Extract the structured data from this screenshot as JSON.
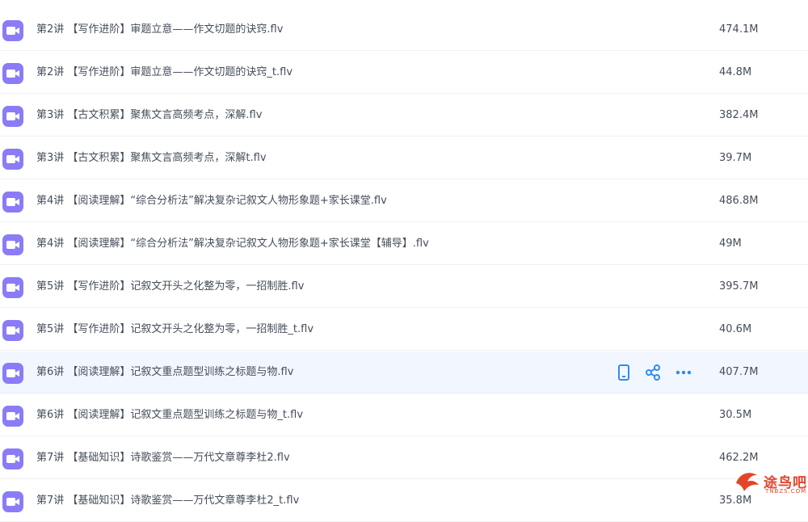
{
  "files": [
    {
      "name": "第2讲 【写作进阶】审题立意——作文切题的诀窍.flv",
      "size": "474.1M"
    },
    {
      "name": "第2讲 【写作进阶】审题立意——作文切题的诀窍_t.flv",
      "size": "44.8M"
    },
    {
      "name": "第3讲 【古文积累】聚焦文言高频考点，深解.flv",
      "size": "382.4M"
    },
    {
      "name": "第3讲 【古文积累】聚焦文言高频考点，深解t.flv",
      "size": "39.7M"
    },
    {
      "name": "第4讲 【阅读理解】“综合分析法”解决复杂记叙文人物形象题+家长课堂.flv",
      "size": "486.8M"
    },
    {
      "name": "第4讲 【阅读理解】“综合分析法”解决复杂记叙文人物形象题+家长课堂【辅导】.flv",
      "size": "49M"
    },
    {
      "name": "第5讲 【写作进阶】记叙文开头之化整为零，一招制胜.flv",
      "size": "395.7M"
    },
    {
      "name": "第5讲 【写作进阶】记叙文开头之化整为零，一招制胜_t.flv",
      "size": "40.6M"
    },
    {
      "name": "第6讲 【阅读理解】记叙文重点题型训练之标题与物.flv",
      "size": "407.7M"
    },
    {
      "name": "第6讲 【阅读理解】记叙文重点题型训练之标题与物_t.flv",
      "size": "30.5M"
    },
    {
      "name": "第7讲 【基础知识】诗歌鉴赏——万代文章尊李杜2.flv",
      "size": "462.2M"
    },
    {
      "name": "第7讲 【基础知识】诗歌鉴赏——万代文章尊李杜2_t.flv",
      "size": "35.8M"
    }
  ],
  "hover_index": 8,
  "icons": {
    "file": "video-file-icon",
    "phone": "phone-icon",
    "share": "share-icon",
    "more": "more-icon"
  },
  "colors": {
    "file_icon": "#8a7cf6",
    "action": "#2f8bf4",
    "hover_bg": "#f2f7ff"
  },
  "watermark": {
    "text": "途鸟吧",
    "sub": "TNBZS.COM"
  }
}
